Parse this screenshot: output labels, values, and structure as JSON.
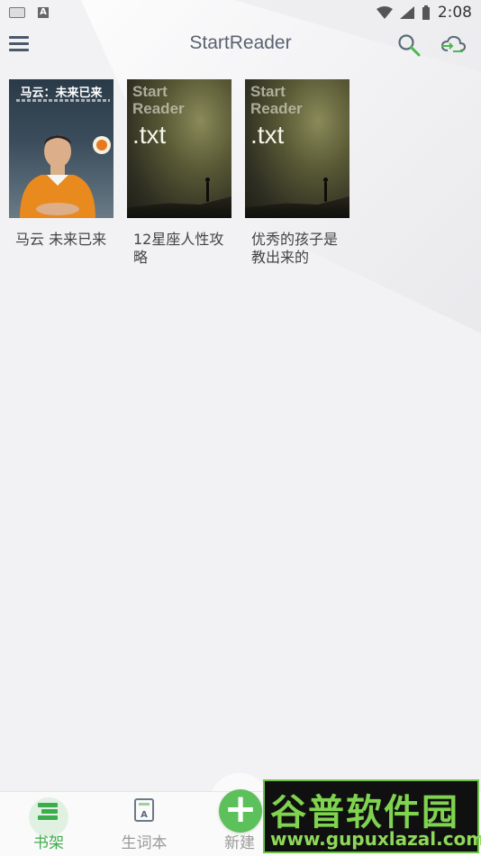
{
  "status_bar": {
    "time": "2:08"
  },
  "toolbar": {
    "title": "StartReader",
    "menu_icon": "hamburger-icon",
    "search_icon": "search-icon",
    "sync_icon": "cloud-sync-icon"
  },
  "books": [
    {
      "title": "马云 未来已来",
      "cover_title": "马云：未来已来",
      "cover_type": "photo"
    },
    {
      "title": "12星座人性攻略",
      "cover_brand": "Start Reader",
      "cover_ext": ".txt",
      "cover_type": "txt"
    },
    {
      "title": "优秀的孩子是教出来的",
      "cover_brand": "Start Reader",
      "cover_ext": ".txt",
      "cover_type": "txt"
    }
  ],
  "bottom_nav": {
    "items": [
      {
        "label": "书架",
        "active": true
      },
      {
        "label": "生词本",
        "active": false
      },
      {
        "label": "新建",
        "active": false
      }
    ]
  },
  "watermark": {
    "logo": "谷普软件园",
    "url": "www.gupuxlazal.com"
  },
  "colors": {
    "accent": "#3cad4c",
    "fab": "#5cc15a"
  }
}
